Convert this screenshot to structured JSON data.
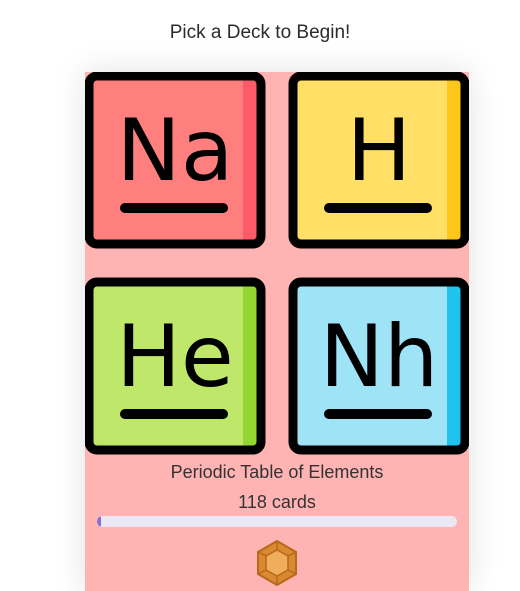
{
  "page": {
    "heading": "Pick a Deck to Begin!"
  },
  "deck": {
    "tiles": [
      {
        "symbol": "Na",
        "color": "#ff7f7f",
        "edge": "#ff5a6a"
      },
      {
        "symbol": "H",
        "color": "#ffdf66",
        "edge": "#ffc61a"
      },
      {
        "symbol": "He",
        "color": "#bfe86b",
        "edge": "#93d632"
      },
      {
        "symbol": "Nh",
        "color": "#9fe3f7",
        "edge": "#1fc4ee"
      }
    ],
    "title": "Periodic Table of Elements",
    "count": "118 cards",
    "progress": 0.01,
    "badge_icon": "hexagon-gem-icon"
  },
  "colors": {
    "card_background": "#ffb3b3",
    "progress_track": "#ebe7f4",
    "progress_fill": "#8a6fd1",
    "badge": "#d9892f"
  }
}
